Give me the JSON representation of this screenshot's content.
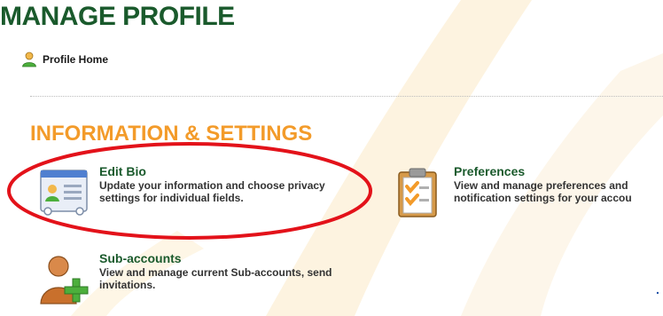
{
  "page": {
    "title": "MANAGE PROFILE"
  },
  "nav": {
    "profile_home_label": "Profile Home"
  },
  "section": {
    "heading": "INFORMATION & SETTINGS"
  },
  "items": [
    {
      "title": "Edit Bio",
      "desc_line1": "Update your information and choose privacy",
      "desc_line2": "settings for individual fields.",
      "icon": "contact-card-icon"
    },
    {
      "title": "Preferences",
      "desc_line1": "View and manage preferences and",
      "desc_line2": "notification settings for your accou",
      "icon": "clipboard-checklist-icon"
    },
    {
      "title": "Sub-accounts",
      "desc_line1": "View and manage current Sub-accounts, send",
      "desc_line2": "invitations.",
      "icon": "add-user-icon"
    }
  ],
  "colors": {
    "title_green": "#1a5a2c",
    "heading_orange": "#f39b2a",
    "annotation_red": "#e3121a",
    "background_swoosh": "#fdf3e0"
  },
  "misc": {
    "corner_mark": "."
  }
}
